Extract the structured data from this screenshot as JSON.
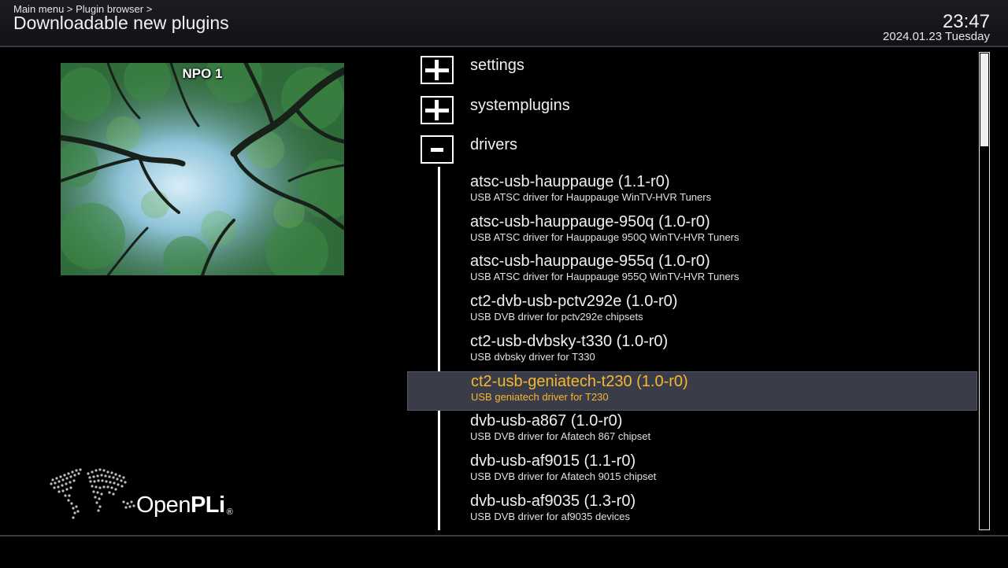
{
  "header": {
    "breadcrumb": "Main menu > Plugin browser >",
    "title": "Downloadable new plugins",
    "time": "23:47",
    "date": "2024.01.23 Tuesday"
  },
  "preview": {
    "channel": "NPO 1"
  },
  "logo": {
    "text_light": "Open",
    "text_bold": "PLi",
    "registered": "®"
  },
  "categories": [
    {
      "label": "settings",
      "state": "collapsed",
      "icon": "plus-icon"
    },
    {
      "label": "systemplugins",
      "state": "collapsed",
      "icon": "plus-icon"
    },
    {
      "label": "drivers",
      "state": "expanded",
      "icon": "minus-icon"
    }
  ],
  "plugins": [
    {
      "name": "atsc-usb-hauppauge  (1.1-r0)",
      "desc": "USB ATSC driver for Hauppauge WinTV-HVR Tuners"
    },
    {
      "name": "atsc-usb-hauppauge-950q  (1.0-r0)",
      "desc": "USB ATSC driver for Hauppauge 950Q WinTV-HVR Tuners"
    },
    {
      "name": "atsc-usb-hauppauge-955q  (1.0-r0)",
      "desc": "USB ATSC driver for Hauppauge 955Q WinTV-HVR Tuners"
    },
    {
      "name": "ct2-dvb-usb-pctv292e  (1.0-r0)",
      "desc": "USB DVB driver for pctv292e chipsets"
    },
    {
      "name": "ct2-usb-dvbsky-t330  (1.0-r0)",
      "desc": "USB dvbsky driver for T330"
    },
    {
      "name": "ct2-usb-geniatech-t230  (1.0-r0)",
      "desc": "USB geniatech driver for T230",
      "selected": true
    },
    {
      "name": "dvb-usb-a867  (1.0-r0)",
      "desc": "USB DVB driver for Afatech 867 chipset"
    },
    {
      "name": "dvb-usb-af9015  (1.1-r0)",
      "desc": "USB DVB driver for Afatech 9015 chipset"
    },
    {
      "name": "dvb-usb-af9035  (1.3-r0)",
      "desc": "USB DVB driver for af9035 devices"
    }
  ],
  "colors": {
    "selected_text": "#f5b82e",
    "selected_bg": "#3a3c4a"
  }
}
